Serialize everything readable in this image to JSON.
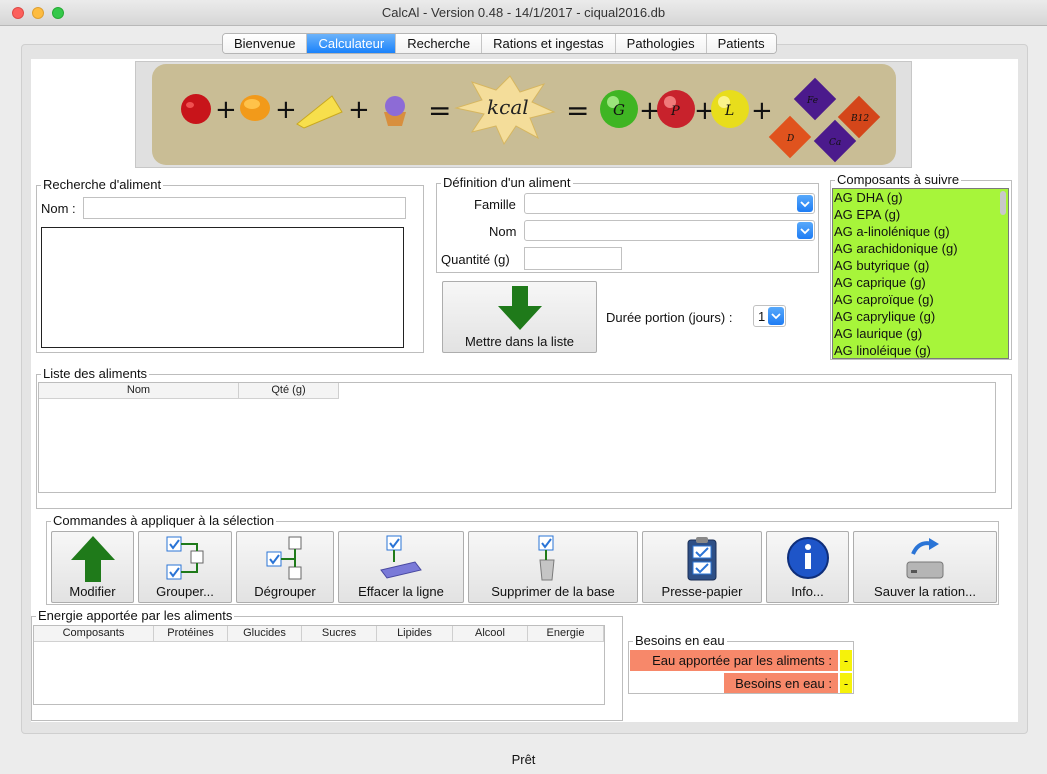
{
  "window": {
    "title": "CalcAl - Version 0.48 - 14/1/2017 - ciqual2016.db"
  },
  "tabs": [
    {
      "label": "Bienvenue",
      "active": false
    },
    {
      "label": "Calculateur",
      "active": true
    },
    {
      "label": "Recherche",
      "active": false
    },
    {
      "label": "Rations et ingestas",
      "active": false
    },
    {
      "label": "Pathologies",
      "active": false
    },
    {
      "label": "Patients",
      "active": false
    }
  ],
  "banner": {
    "kcal": "kcal",
    "g": "G",
    "p": "P",
    "l": "L",
    "fe": "Fe",
    "b12": "B12",
    "d": "D",
    "ca": "Ca"
  },
  "search": {
    "title": "Recherche d'aliment",
    "name_label": "Nom :",
    "name_value": ""
  },
  "definition": {
    "title": "Définition d'un aliment",
    "famille_label": "Famille",
    "famille_value": "",
    "nom_label": "Nom",
    "nom_value": "",
    "quantite_label": "Quantité (g)",
    "quantite_value": ""
  },
  "add_button": {
    "label": "Mettre dans la liste",
    "icon": "down-arrow-icon"
  },
  "duree": {
    "label": "Durée portion (jours) :",
    "value": "1"
  },
  "composants": {
    "title": "Composants à suivre",
    "items": [
      "AG DHA (g)",
      "AG EPA (g)",
      "AG a-linolénique (g)",
      "AG arachidonique (g)",
      "AG butyrique (g)",
      "AG caprique (g)",
      "AG caproïque (g)",
      "AG caprylique (g)",
      "AG laurique (g)",
      "AG linoléique (g)"
    ],
    "highlight_color": "#a7f53a"
  },
  "food_list": {
    "title": "Liste des aliments",
    "columns": [
      "Nom",
      "Qté (g)"
    ]
  },
  "commands": {
    "title": "Commandes à appliquer à la sélection",
    "buttons": [
      {
        "label": "Modifier",
        "icon": "up-arrow-icon"
      },
      {
        "label": "Grouper...",
        "icon": "group-icon"
      },
      {
        "label": "Dégrouper",
        "icon": "ungroup-icon"
      },
      {
        "label": "Effacer la ligne",
        "icon": "eraser-icon"
      },
      {
        "label": "Supprimer de la base",
        "icon": "trash-icon"
      },
      {
        "label": "Presse-papier",
        "icon": "clipboard-icon"
      },
      {
        "label": "Info...",
        "icon": "info-icon"
      },
      {
        "label": "Sauver la ration...",
        "icon": "save-drive-icon"
      }
    ]
  },
  "energy": {
    "title": "Energie apportée par les aliments",
    "columns": [
      "Composants",
      "Protéines",
      "Glucides",
      "Sucres",
      "Lipides",
      "Alcool",
      "Energie"
    ]
  },
  "water": {
    "title": "Besoins en eau",
    "rows": [
      {
        "label": "Eau apportée par les aliments :",
        "value": "-"
      },
      {
        "label": "Besoins en eau :",
        "value": "-"
      }
    ]
  },
  "status": {
    "text": "Prêt"
  }
}
